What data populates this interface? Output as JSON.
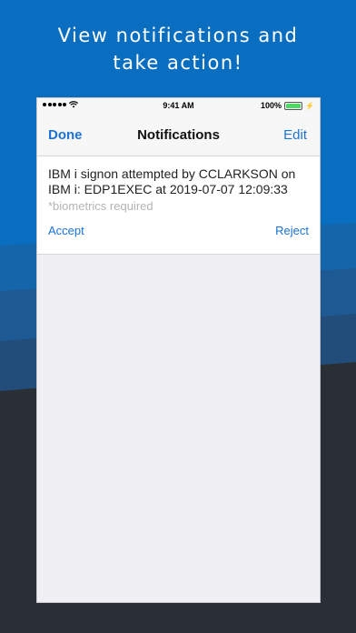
{
  "headline": {
    "line1": "View notifications and",
    "line2": "take action!"
  },
  "colors": {
    "accent": "#1a73d9",
    "bg_top": "#0a6ec0",
    "bg_bottom": "#2a2f36",
    "battery": "#4cd964"
  },
  "status_bar": {
    "time": "9:41 AM",
    "battery_percent": "100%",
    "battery_level": 1.0,
    "signal_icon": "signal-dots-icon",
    "wifi_icon": "wifi-icon",
    "charging_icon": "bolt-icon"
  },
  "navbar": {
    "done_label": "Done",
    "title": "Notifications",
    "edit_label": "Edit"
  },
  "notification": {
    "line1": "IBM i signon attempted by CCLARKSON on",
    "line2": "IBM i: EDP1EXEC at 2019-07-07 12:09:33",
    "note": "*biometrics required",
    "accept_label": "Accept",
    "reject_label": "Reject"
  }
}
